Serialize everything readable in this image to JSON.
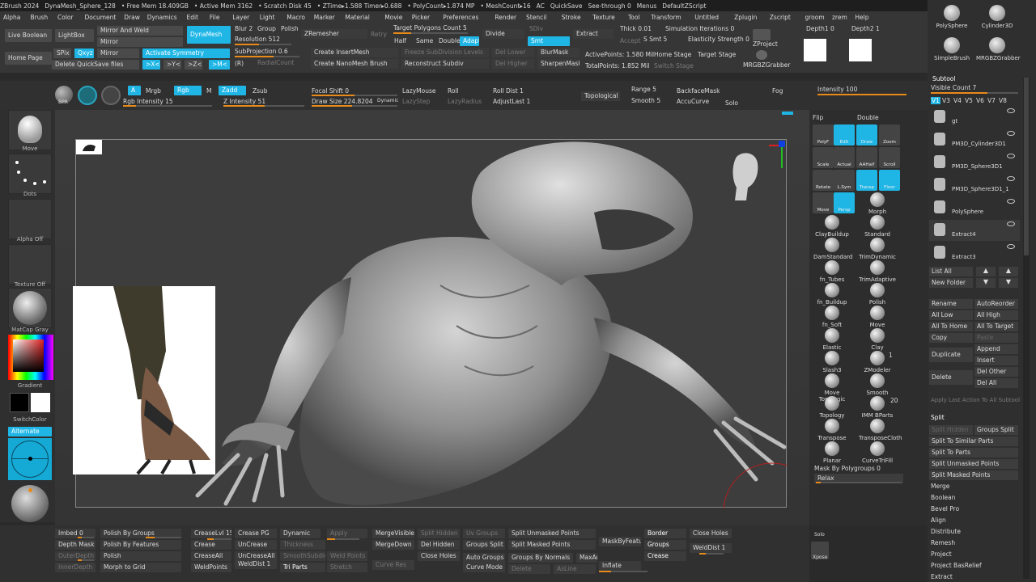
{
  "menubar": {
    "items": [
      "ZBrush 2024",
      "DynaMesh_Sphere_128",
      "• Free Mem 18.409GB",
      "• Active Mem 3162",
      "• Scratch Disk 45",
      "• ZTime▸1.588 Timer▸0.688",
      "• PolyCount▸1.874 MP",
      "• MeshCount▸16",
      "AC",
      "QuickSave",
      "See-through 0",
      "Menus",
      "DefaultZScript"
    ],
    "menus": [
      "Alpha",
      "Brush",
      "Color",
      "Document",
      "Draw",
      "Dynamics",
      "Edit",
      "File",
      "Layer",
      "Light",
      "Macro",
      "Marker",
      "Material",
      "Movie",
      "Picker",
      "Preferences",
      "Render",
      "Stencil",
      "Stroke",
      "Texture",
      "Tool",
      "Transform",
      "Untitled",
      "Zplugin",
      "Zscript",
      "groom",
      "zrem",
      "Help"
    ]
  },
  "top": {
    "live_boolean": "Live Boolean",
    "lightbox": "LightBox",
    "home_page": "Home Page",
    "mirror_and_weld": "Mirror And Weld",
    "mirror": "Mirror",
    "mirror2": "Mirror",
    "dynamesh": "DynaMesh",
    "blur": "Blur 2",
    "group": "Group",
    "polish": "Polish",
    "resolution": "Resolution 512",
    "zremesher": "ZRemesher",
    "retry": "Retry",
    "target_polys": "Target Polygons Count 5",
    "half": "Half",
    "same": "Same",
    "double": "Double",
    "adapt": "Adapt",
    "divide": "Divide",
    "sdiv": "SDiv",
    "smt": "Smt",
    "extract": "Extract",
    "thick": "Thick 0.01",
    "accept": "Accept",
    "sim_iter": "Simulation Iterations 0",
    "s_smt": "S Smt 5",
    "elasticity": "Elasticity Strength 0",
    "zproject": "ZProject",
    "mrgb": "MRGBZGrabber",
    "depth1": "Depth1 0",
    "depth2": "Depth2 1",
    "spix": "SPix 3",
    "xyz": "Qxyz",
    "activate_sym": "Activate Symmetry",
    "axis_x": ">X<",
    "axis_y": ">Y<",
    "axis_z": ">Z<",
    "axis_m": ">M<",
    "axis_r": "(R)",
    "del_quicksave": "Delete QuickSave files",
    "subprojection": "SubProjection 0.6",
    "radialcount": "RadialCount",
    "create_insert": "Create InsertMesh",
    "create_nano": "Create NanoMesh Brush",
    "freeze_sub": "Freeze SubDivision Levels",
    "reconstruct": "Reconstruct Subdiv",
    "del_lower": "Del Lower",
    "del_higher": "Del Higher",
    "blurmask": "BlurMask",
    "sharpenmask": "SharpenMask",
    "active_points": "ActivePoints: 1.580 Mil",
    "total_points": "TotalPoints: 1.852 Mil",
    "home_stage": "Home Stage",
    "target_stage": "Target Stage",
    "switch_stage": "Switch Stage"
  },
  "strip2": {
    "bpr": "BPR",
    "a": "A",
    "mrgb": "Mrgb",
    "rgb": "Rgb",
    "m": "M",
    "zadd": "Zadd",
    "zsub": "Zsub",
    "rgb_intensity": "Rgb Intensity 15",
    "z_intensity": "Z Intensity 51",
    "focal_shift": "Focal Shift 0",
    "draw_size": "Draw Size 224.8204",
    "dynamic": "Dynamic",
    "lazymouse": "LazyMouse",
    "lazystep": "LazyStep",
    "roll": "Roll",
    "lazyradius": "LazyRadius",
    "roll_dist": "Roll Dist 1",
    "adjust_last": "AdjustLast 1",
    "topological": "Topological",
    "range": "Range 5",
    "smooth": "Smooth 5",
    "backfacemask": "BackfaceMask",
    "accucurve": "AccuCurve",
    "solo": "Solo",
    "fog": "Fog",
    "intensity": "Intensity 100"
  },
  "left": {
    "tiles": [
      "Move",
      "Dots",
      "Alpha Off",
      "Texture Off",
      "MatCap Gray"
    ],
    "gradient": "Gradient",
    "switch_color": "SwitchColor",
    "alternate": "Alternate"
  },
  "right": {
    "flip": "Flip",
    "double": "Double",
    "nav": [
      "PolyF",
      "Edit",
      "Draw",
      "Zoom",
      "Scale",
      "Actual",
      "AAHalf",
      "Scroll",
      "Rotate",
      "L.Sym",
      "Transp",
      "Floor",
      "Move",
      "Persp"
    ],
    "brushes": [
      "Morph",
      "ClayBuildup",
      "Standard",
      "DamStandard",
      "TrimDynamic",
      "fn_Tubes",
      "TrimAdaptive",
      "fn_Buildup",
      "Polish",
      "fn_Soft",
      "Move",
      "Elastic",
      "Clay",
      "Slash3",
      "ZModeler",
      "Move Topologic",
      "Smooth",
      "Topology",
      "IMM BParts",
      "Transpose",
      "TransposeCloth",
      "Planar",
      "CurveTriFill"
    ],
    "zmodeler_count": "1",
    "imm_count": "20",
    "mask_polygroups": "Mask By Polygroups 0",
    "relax": "Relax",
    "solo": "Solo",
    "xpose": "Xpose"
  },
  "bottom": {
    "imbed": "Imbed 0",
    "polish_groups": "Polish By Groups",
    "polish_features": "Polish By Features",
    "polish": "Polish",
    "depth_mask": "Depth Mask",
    "outer_depth": "OuterDepth",
    "inner_depth": "InnerDepth",
    "morph_grid": "Morph to Grid",
    "crease_lvl": "CreaseLvl 15",
    "crease_pg": "Crease PG",
    "crease": "Crease",
    "crease_all": "CreaseAll",
    "weld_points": "WeldPoints",
    "dynamic": "Dynamic",
    "apply": "Apply",
    "uncrease": "UnCrease",
    "uncrease_all": "UnCreaseAll",
    "weld_dist": "WeldDist 1",
    "thickness": "Thickness",
    "smooth_subdiv": "SmoothSubdiv",
    "weld_points2": "Weld Points",
    "tri_parts": "Tri Parts",
    "stretch": "Stretch",
    "merge_visible": "MergeVisible",
    "merge_down": "MergeDown",
    "curve_res": "Curve Res",
    "split_hidden": "Split Hidden",
    "del_hidden": "Del Hidden",
    "close_holes": "Close Holes",
    "uv_groups": "Uv Groups",
    "groups_split": "Groups Split",
    "auto_groups": "Auto Groups",
    "curve_mode": "Curve Mode",
    "split_unmasked": "Split Unmasked Points",
    "split_masked": "Split Masked Points",
    "groups_normals": "Groups By Normals",
    "maxan": "MaxAn",
    "delete": "Delete",
    "asline": "AsLine",
    "mask_by_feature": "MaskByFeature",
    "inflate": "Inflate",
    "border": "Border",
    "groups": "Groups",
    "crease2": "Crease",
    "close_holes2": "Close Holes",
    "weld_dist2": "WeldDist 1"
  },
  "panel": {
    "tools": [
      "PolySphere",
      "Cylinder3D",
      "SimpleBrush",
      "MRGBZGrabber"
    ],
    "subtool_title": "Subtool",
    "visible_count": "Visible Count 7",
    "versions": [
      "V1",
      "V3",
      "V4",
      "V5",
      "V6",
      "V7",
      "V8"
    ],
    "subtools": [
      "gt",
      "PM3D_Cylinder3D1",
      "PM3D_Sphere3D1",
      "PM3D_Sphere3D1_1",
      "PolySphere",
      "Extract4",
      "Extract3"
    ],
    "list_all": "List All",
    "new_folder": "New Folder",
    "rename": "Rename",
    "autoreorder": "AutoReorder",
    "all_low": "All Low",
    "all_high": "All High",
    "all_home": "All To Home",
    "all_target": "All To Target",
    "copy": "Copy",
    "paste": "Paste",
    "duplicate": "Duplicate",
    "append": "Append",
    "insert": "Insert",
    "delete": "Delete",
    "del_other": "Del Other",
    "del_all": "Del All",
    "apply_last": "Apply Last Action To All Subtool",
    "split": "Split",
    "split_hidden": "Split Hidden",
    "groups_split": "Groups Split",
    "split_similar": "Split To Similar Parts",
    "split_parts": "Split To Parts",
    "split_unmasked": "Split Unmasked Points",
    "split_masked": "Split Masked Points",
    "menu_items": [
      "Merge",
      "Boolean",
      "Bevel Pro",
      "Align",
      "Distribute",
      "Remesh",
      "Project",
      "Project BasRelief",
      "Extract"
    ]
  },
  "colors": {
    "accent": "#1fb6e6",
    "slider": "#e88a1a"
  }
}
